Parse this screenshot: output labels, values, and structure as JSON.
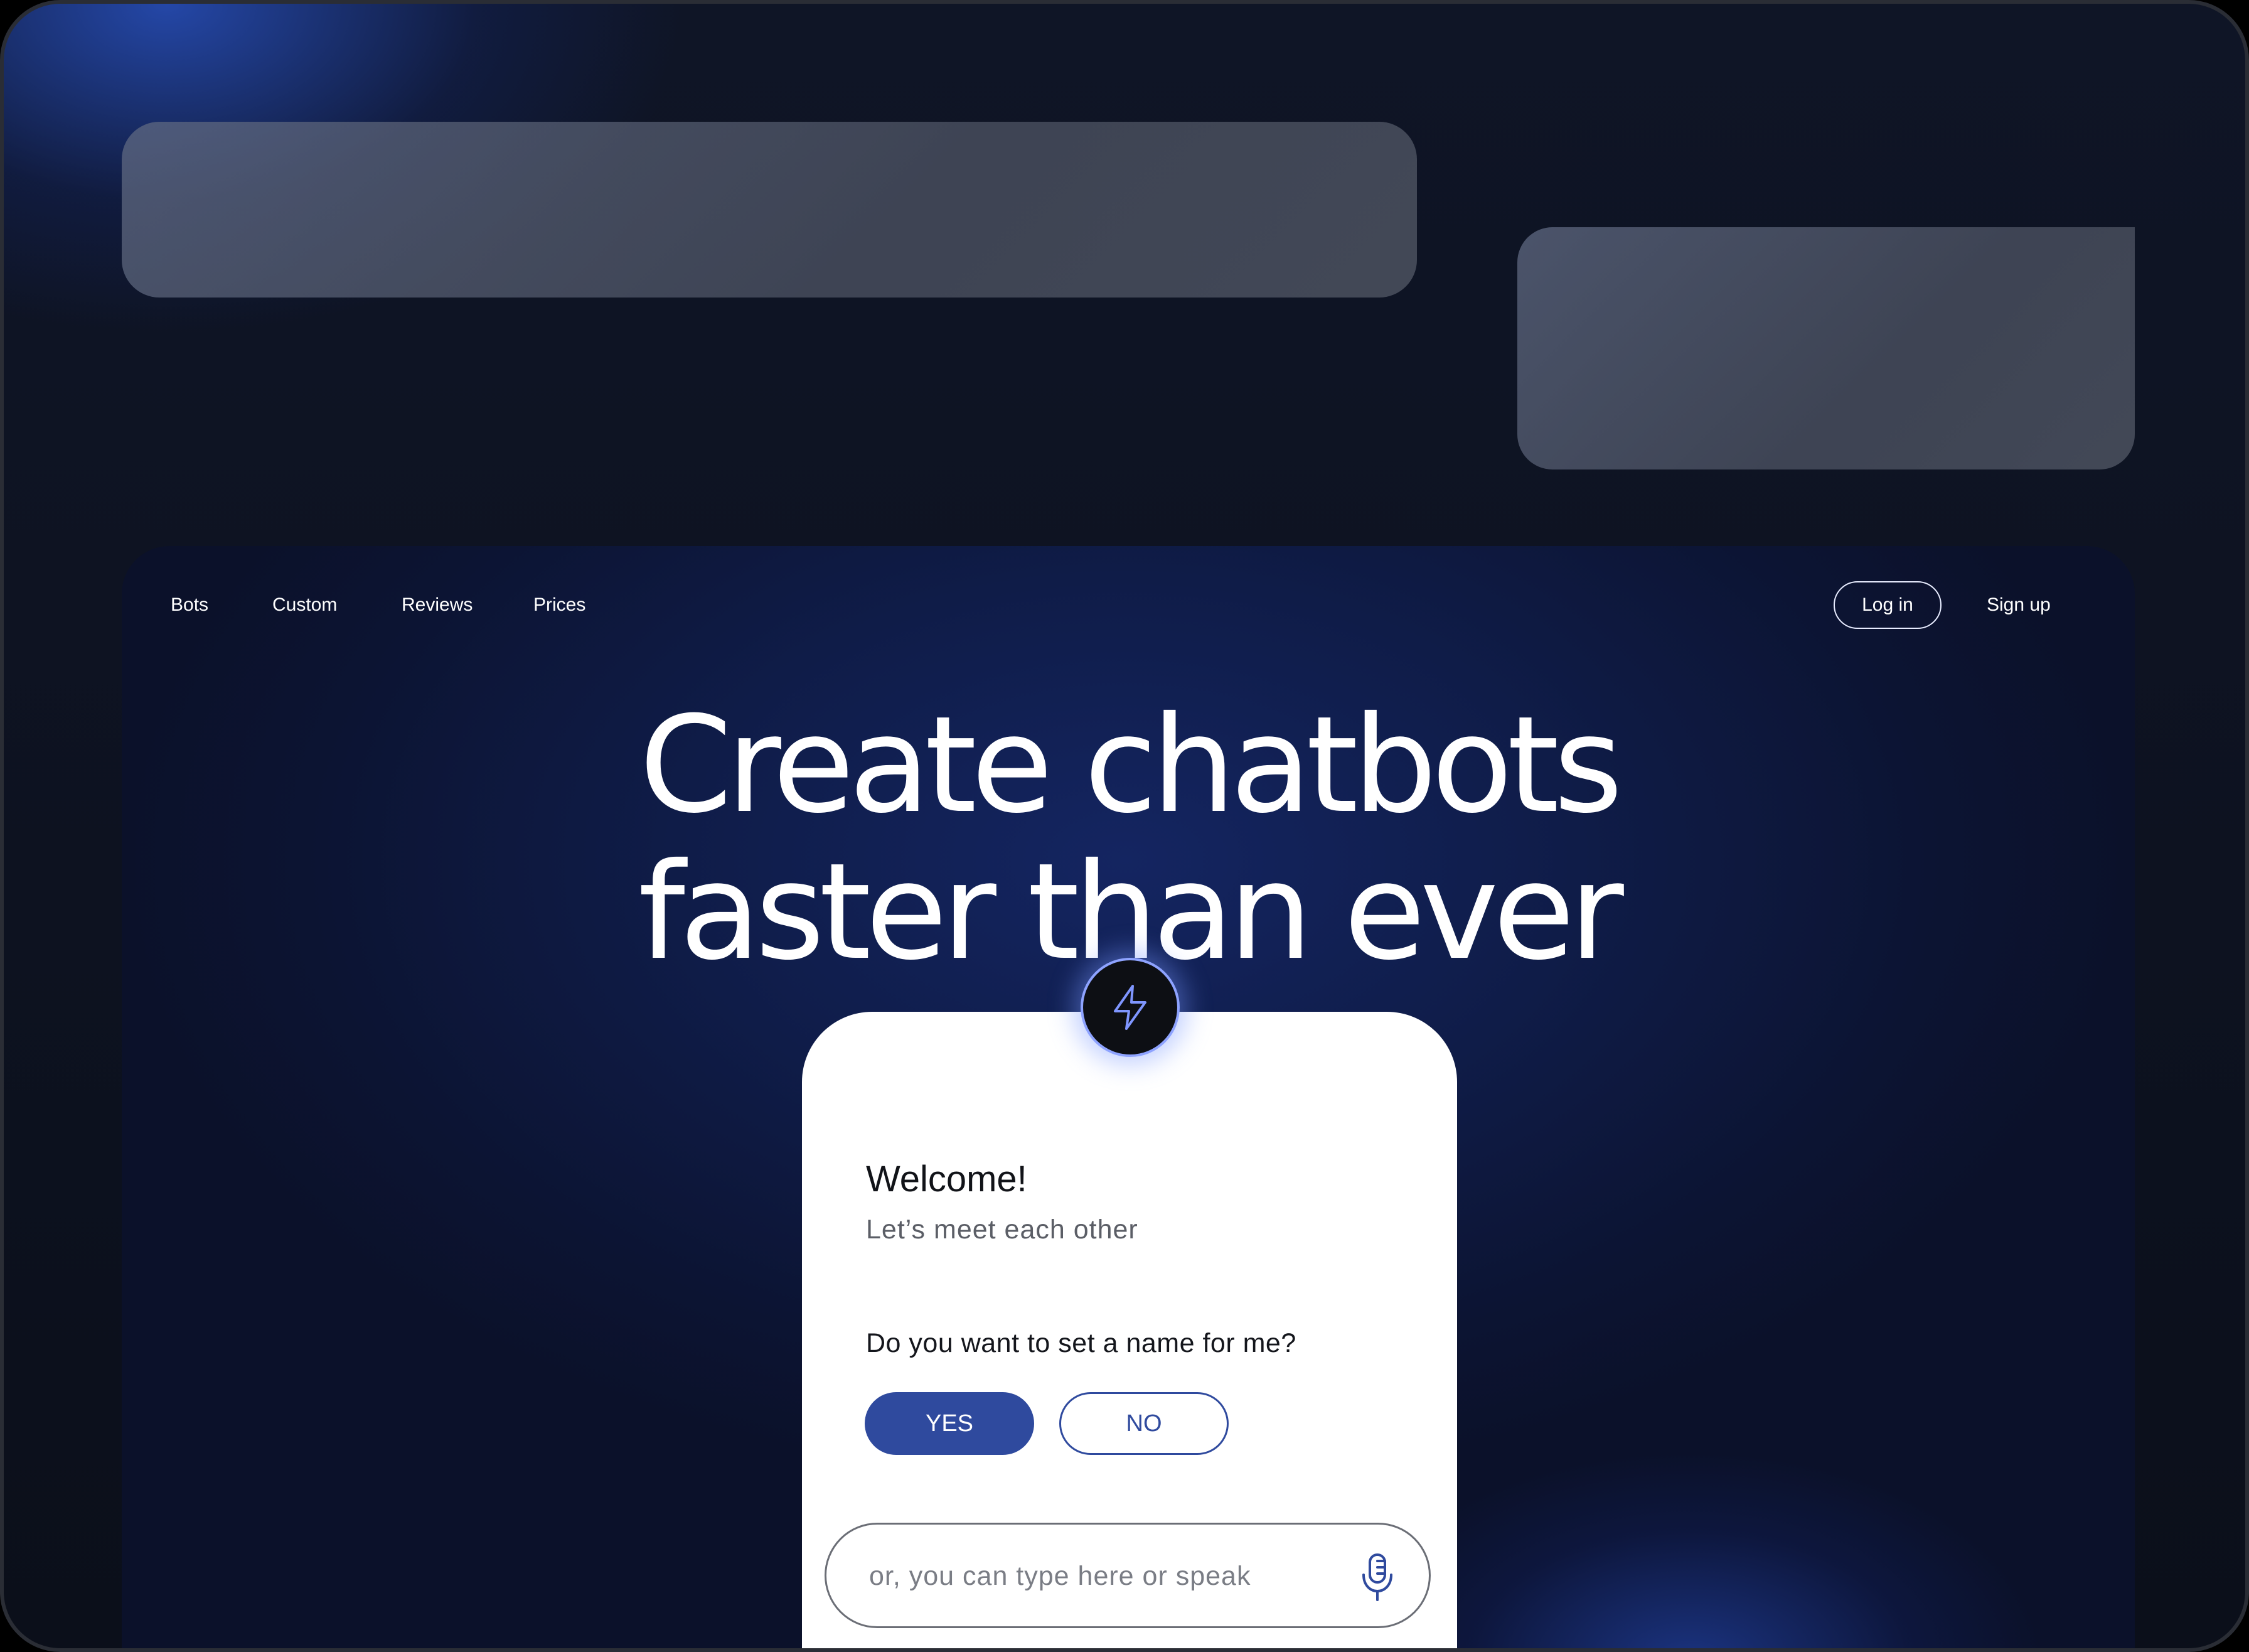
{
  "nav": {
    "links": [
      "Bots",
      "Custom",
      "Reviews",
      "Prices"
    ],
    "login_label": "Log in",
    "signup_label": "Sign up"
  },
  "hero": {
    "line1": "Create chatbots",
    "line2": "faster than ever"
  },
  "chat_card": {
    "badge_icon": "lightning-bolt-icon",
    "welcome": "Welcome!",
    "subtitle": "Let’s meet each other",
    "question": "Do you want to set a name for me?",
    "yes_label": "YES",
    "no_label": "NO",
    "input_placeholder": "or, you can type here or speak",
    "mic_icon": "microphone-icon"
  },
  "colors": {
    "accent": "#2f4a9e",
    "badge_glow": "#8ea3ff",
    "background": "#0f1c48"
  }
}
